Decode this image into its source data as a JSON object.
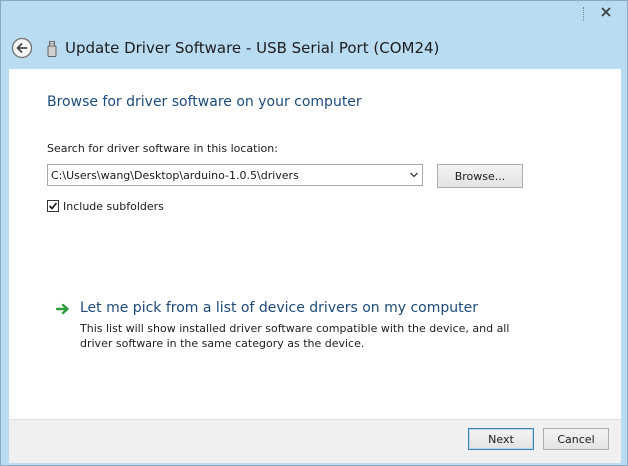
{
  "window": {
    "title": "Update Driver Software - USB Serial Port (COM24)",
    "close_icon": "close-icon",
    "back_icon": "back-arrow-icon",
    "device_icon": "usb-device-icon"
  },
  "main": {
    "heading": "Browse for driver software on your computer",
    "search_label": "Search for driver software in this location:",
    "path_value": "C:\\Users\\wang\\Desktop\\arduino-1.0.5\\drivers",
    "browse_label": "Browse...",
    "include_subfolders_label": "Include subfolders",
    "include_subfolders_checked": true,
    "pick_title": "Let me pick from a list of device drivers on my computer",
    "pick_description": "This list will show installed driver software compatible with the device, and all driver software in the same category as the device."
  },
  "footer": {
    "next_label": "Next",
    "cancel_label": "Cancel"
  },
  "colors": {
    "frame": "#b9dcf2",
    "heading": "#1d4b7a",
    "arrow_green": "#2e9e3e"
  }
}
